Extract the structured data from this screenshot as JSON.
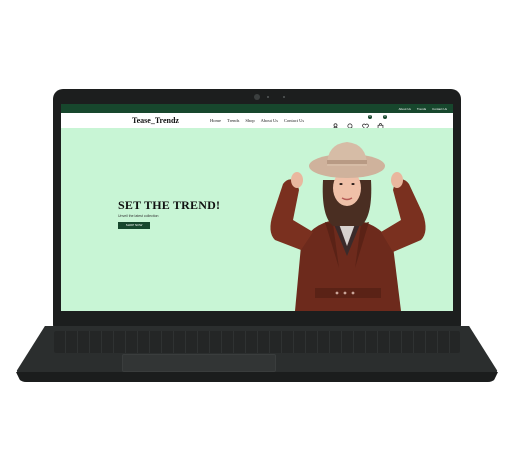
{
  "site": {
    "top_links": [
      "About Us",
      "Trends",
      "Contact Us"
    ],
    "brand": "Tease_Trendz",
    "menu": [
      "Home",
      "Trends",
      "Shop",
      "About Us",
      "Contact Us"
    ],
    "icons": [
      "user-icon",
      "search-icon",
      "heart-icon",
      "bag-icon"
    ],
    "wishlist_count": "0",
    "cart_count": "0",
    "hero": {
      "title": "SET THE TREND!",
      "subtitle": "Unveil the latest collection",
      "button": "SHOP NOW"
    }
  },
  "colors": {
    "accent": "#17472d",
    "hero_bg": "#c8f5d5",
    "laptop": "#1c1e1e"
  }
}
